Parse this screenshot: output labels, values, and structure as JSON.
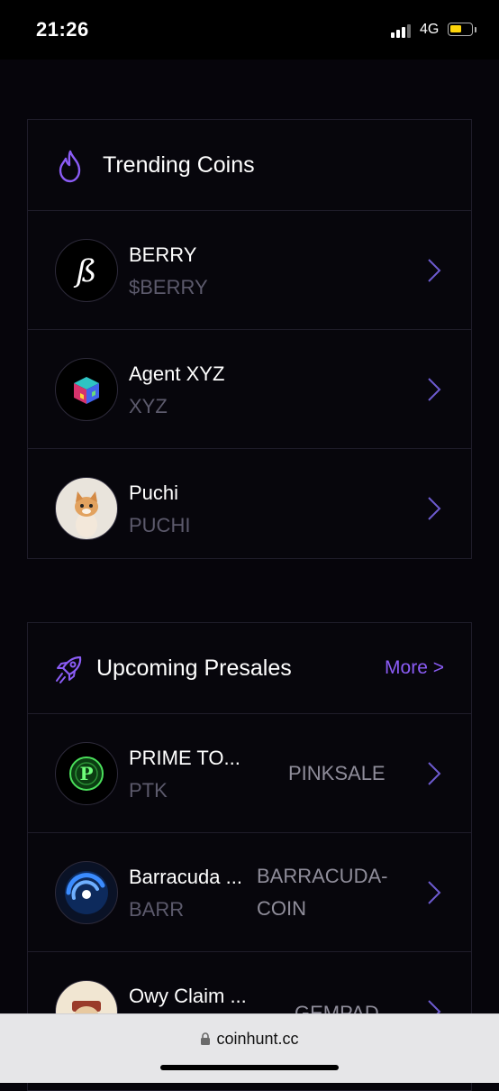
{
  "status_bar": {
    "time": "21:26",
    "network": "4G"
  },
  "trending": {
    "title": "Trending Coins",
    "icon": "flame-icon",
    "accent": "#8b5cf6",
    "items": [
      {
        "name": "BERRY",
        "ticker": "$BERRY",
        "icon": "berry-logo-icon"
      },
      {
        "name": "Agent XYZ",
        "ticker": "XYZ",
        "icon": "cube-logo-icon"
      },
      {
        "name": "Puchi",
        "ticker": "PUCHI",
        "icon": "kitten-avatar-icon"
      }
    ]
  },
  "presales": {
    "title": "Upcoming Presales",
    "icon": "rocket-icon",
    "more_label": "More >",
    "items": [
      {
        "name": "PRIME TO...",
        "ticker": "PTK",
        "launchpad_line1": "PINKSALE",
        "launchpad_line2": "",
        "icon": "prime-token-logo-icon"
      },
      {
        "name": "Barracuda ...",
        "ticker": "BARR",
        "launchpad_line1": "BARRACUDA-",
        "launchpad_line2": "COIN",
        "icon": "barracuda-logo-icon"
      },
      {
        "name": "Owy Claim ...",
        "ticker": "",
        "launchpad_line1": "GEMPAD",
        "launchpad_line2": "",
        "icon": "owy-avatar-icon"
      }
    ]
  },
  "browser": {
    "url": "coinhunt.cc"
  }
}
